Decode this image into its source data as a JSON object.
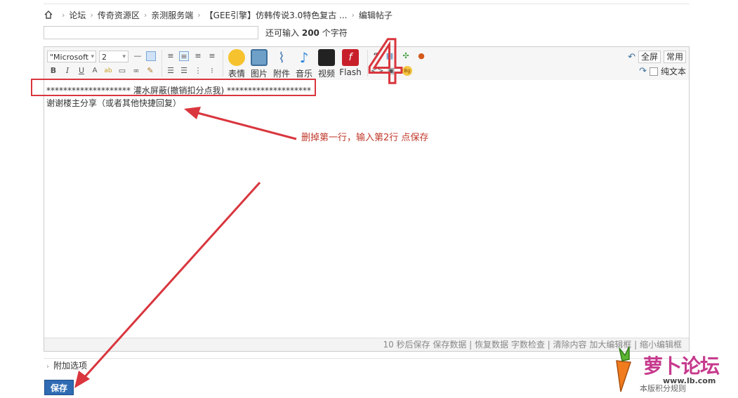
{
  "breadcrumb": {
    "items": [
      "论坛",
      "传奇资源区",
      "亲测服务端",
      "【GEE引擎】仿韩传说3.0特色复古 ...",
      "编辑帖子"
    ]
  },
  "title_field": {
    "value": "",
    "remain_prefix": "还可输入",
    "remain_count": "200",
    "remain_suffix": "个字符"
  },
  "toolbar": {
    "font_family": "\"Microsoft",
    "font_size": "2",
    "buttons": [
      "表情",
      "图片",
      "附件",
      "音乐",
      "视频",
      "Flash"
    ],
    "fullscreen": "全屏",
    "common": "常用",
    "plaintext": "纯文本"
  },
  "content": {
    "line1": "******************** 灌水屏蔽(撤销扣分点我) ********************",
    "line2": "谢谢楼主分享（或者其他快捷回复）"
  },
  "statusbar": {
    "text": "10 秒后保存 保存数据 | 恢复数据    字数检查 | 清除内容    加大编辑框 | 缩小编辑框"
  },
  "extra": {
    "label": "附加选项"
  },
  "save": {
    "label": "保存"
  },
  "version": "本版积分规则",
  "annotation": {
    "number": "4",
    "instruction": "删掉第一行，输入第2行 点保存"
  },
  "logo": {
    "text": "萝卜论坛",
    "url": "www.lb.com"
  },
  "colors": {
    "annotation": "#d9363e",
    "save": "#2e6bb3",
    "logo": "#c63a8d"
  }
}
